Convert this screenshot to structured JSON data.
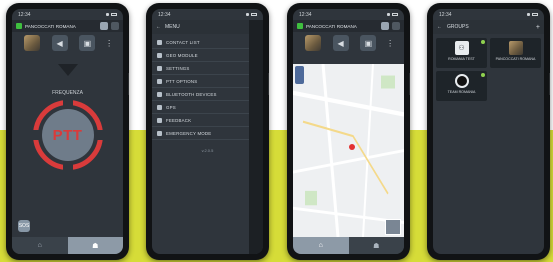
{
  "status_bar": {
    "time": "12:34"
  },
  "header": {
    "user_name": "PANCOCCATI ROMANA"
  },
  "phone1": {
    "ptt_state": "FREQUENZA",
    "ptt_label": "PTT",
    "key_label": "SOS",
    "nav": [
      "home-icon",
      "contacts-icon"
    ]
  },
  "phone2": {
    "menu_title": "MENU",
    "items": [
      "CONTACT LIST",
      "GEO MODULE",
      "SETTINGS",
      "PTT OPTIONS",
      "BLUETOOTH DEVICES",
      "GPS",
      "FEEDBACK",
      "EMERGENCY MODE"
    ],
    "footer": "v.2.0.5"
  },
  "phone4": {
    "title": "GROUPS",
    "groups": [
      {
        "name": "ROMANIA TEST",
        "sub": ""
      },
      {
        "name": "PANCOCCATI ROMANA",
        "sub": ""
      },
      {
        "name": "TEAM ROMANIA",
        "sub": ""
      }
    ]
  },
  "colors": {
    "accent_red": "#d93b3b",
    "lime": "#d6dc38",
    "status_green": "#3fbf3f"
  }
}
